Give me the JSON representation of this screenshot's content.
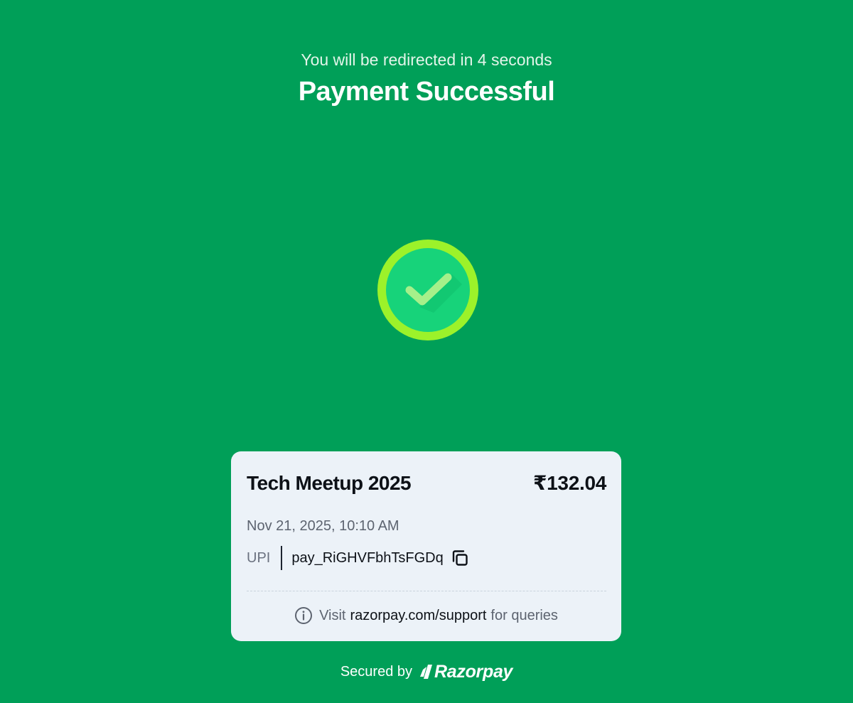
{
  "header": {
    "redirect_text": "You will be redirected in 4 seconds",
    "title": "Payment Successful"
  },
  "status": {
    "icon": "check-circle-icon"
  },
  "card": {
    "merchant_name": "Tech Meetup 2025",
    "amount": "₹132.04",
    "datetime": "Nov 21, 2025, 10:10 AM",
    "method": "UPI",
    "payment_id": "pay_RiGHVFbhTsFGDq",
    "support": {
      "prefix": "Visit",
      "link": "razorpay.com/support",
      "suffix": "for queries"
    }
  },
  "footer": {
    "secured_by": "Secured by",
    "brand": "Razorpay"
  },
  "colors": {
    "background": "#009f58",
    "card_background": "#ecf2f8",
    "ring": "#9cf22a",
    "check_disk": "#17d37a"
  }
}
